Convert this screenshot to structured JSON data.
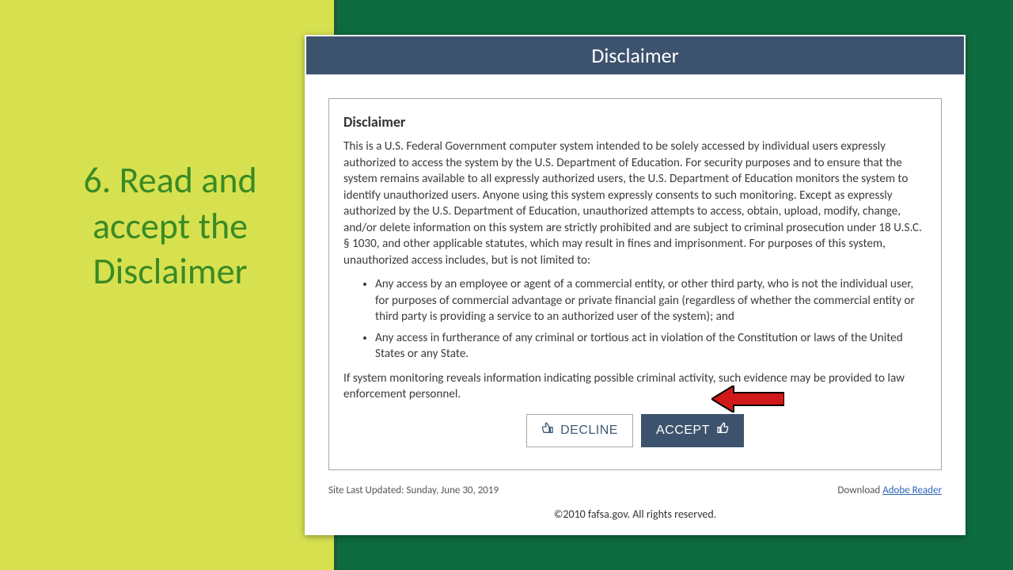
{
  "slide": {
    "step_title": "6. Read and accept the Disclaimer"
  },
  "modal": {
    "titlebar": "Disclaimer",
    "heading": "Disclaimer",
    "para1": "This is a U.S. Federal Government computer system intended to be solely accessed by individual users expressly authorized to access the system by the U.S. Department of Education. For security purposes and to ensure that the system remains available to all expressly authorized users, the U.S. Department of Education monitors the system to identify unauthorized users. Anyone using this system expressly consents to such monitoring. Except as expressly authorized by the U.S. Department of Education, unauthorized attempts to access, obtain, upload, modify, change, and/or delete information on this system are strictly prohibited and are subject to criminal prosecution under 18 U.S.C. § 1030, and other applicable statutes, which may result in fines and imprisonment. For purposes of this system, unauthorized access includes, but is not limited to:",
    "bullet1": "Any access by an employee or agent of a commercial entity, or other third party, who is not the individual user, for purposes of commercial advantage or private financial gain (regardless of whether the commercial entity or third party is providing a service to an authorized user of the system); and",
    "bullet2": "Any access in furtherance of any criminal or tortious act in violation of the Constitution or laws of the United States or any State.",
    "para2": "If system monitoring reveals information indicating possible criminal activity, such evidence may be provided to law enforcement personnel.",
    "decline_label": "DECLINE",
    "accept_label": "ACCEPT"
  },
  "footer": {
    "last_updated": "Site Last Updated: Sunday, June 30, 2019",
    "download_prefix": "Download ",
    "download_link": "Adobe Reader",
    "copyright": "©2010 fafsa.gov. All rights reserved."
  }
}
